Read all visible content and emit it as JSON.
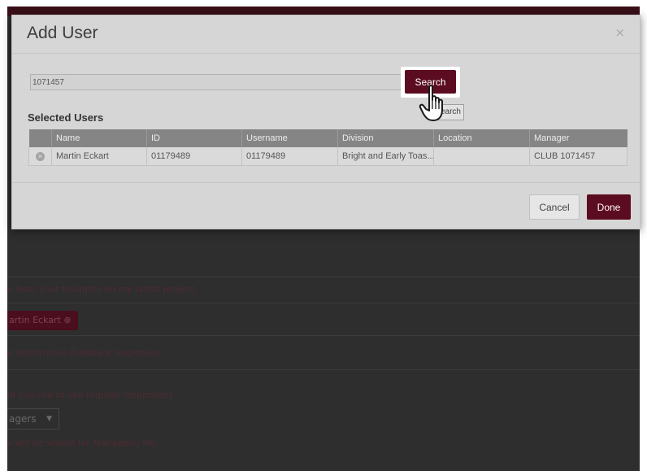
{
  "modal": {
    "title": "Add User",
    "close_symbol": "×",
    "search": {
      "value": "1071457",
      "button_label": "Search",
      "tooltip": "Search"
    },
    "selected_users_title": "Selected Users",
    "table": {
      "columns": [
        "",
        "Name",
        "ID",
        "Username",
        "Division",
        "Location",
        "Manager"
      ],
      "rows": [
        {
          "remove_icon": "x-circle-icon",
          "name": "Martin Eckart",
          "id": "01179489",
          "username": "01179489",
          "division": "Bright and Early Toas...",
          "location": "",
          "manager": "CLUB 1071457"
        }
      ]
    },
    "cancel_label": "Cancel",
    "done_label": "Done"
  },
  "background": {
    "line1": "o hear your thoughts on my latest project.",
    "chip_label": "artin Eckart",
    "chip_remove": "⊗",
    "line2": "e anonymous feedback responses",
    "line3": "ld you like to see request responses?",
    "select_value": "agers",
    "select_caret": "▼",
    "line4": "s will be visible for Managers, Me."
  },
  "colors": {
    "accent": "#5c0c20",
    "overlay": "#2e2e2e",
    "modal_bg": "#d6d6d6",
    "table_header": "#858585"
  }
}
